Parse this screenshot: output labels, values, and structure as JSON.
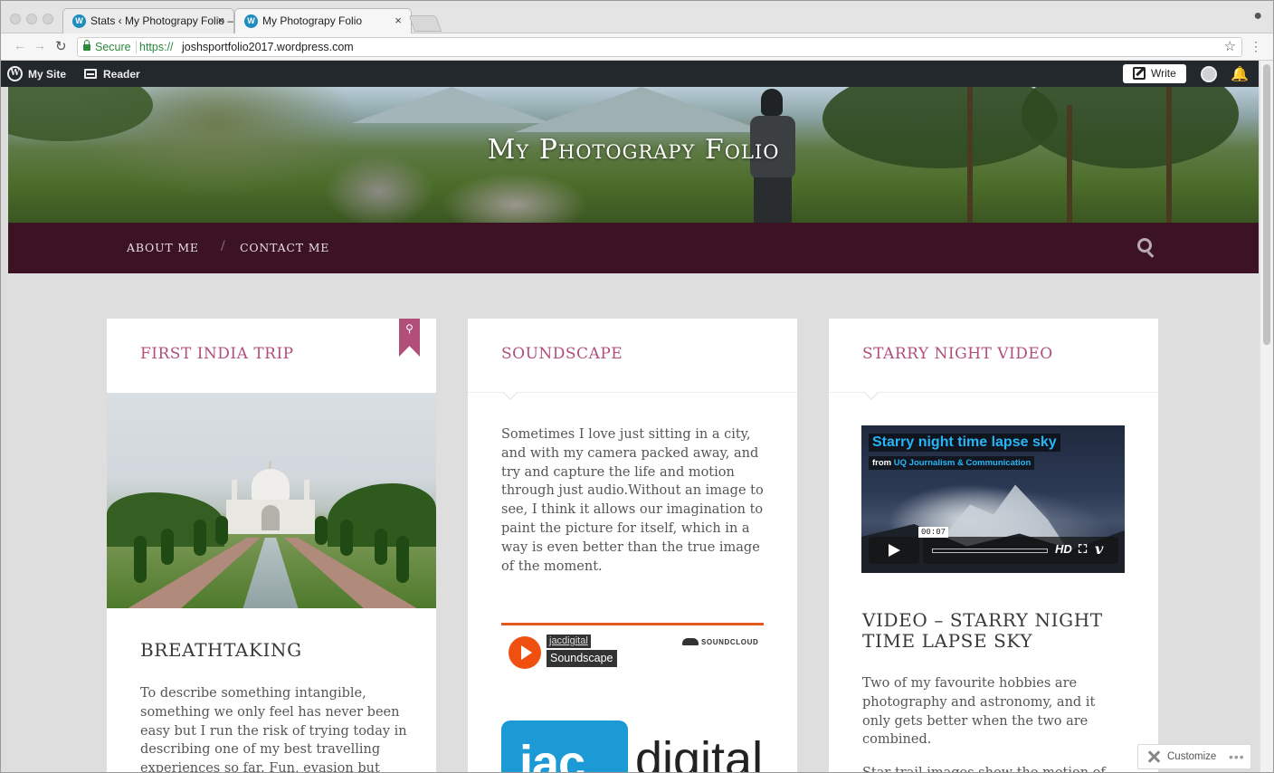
{
  "browser": {
    "tabs": [
      {
        "label": "Stats ‹ My Photograpy Folio —",
        "active": false
      },
      {
        "label": "My Photograpy Folio",
        "active": true
      }
    ],
    "tab_close_glyph": "×",
    "address": {
      "secure_label": "Secure",
      "scheme": "https://",
      "host": "joshsportfolio2017.wordpress.com"
    },
    "icons": [
      "back-arrow-icon",
      "forward-arrow-icon",
      "reload-icon",
      "lock-icon",
      "star-icon",
      "kebab-menu-icon",
      "profile-icon"
    ]
  },
  "admin_bar": {
    "my_site": "My Site",
    "reader": "Reader",
    "write": "Write",
    "bg_color": "#23282d"
  },
  "site": {
    "title": "My Photograpy Folio",
    "menu": [
      {
        "label": "ABOUT ME"
      },
      {
        "label": "CONTACT ME"
      }
    ],
    "menu_separator": "/",
    "menu_bg": "#3b1323",
    "accent_color": "#b24e7a"
  },
  "posts": [
    {
      "title": "FIRST INDIA TRIP",
      "sticky": true,
      "heading": "BREATHTAKING",
      "excerpt": "To describe something intangible, something we only feel has never been easy but I run the risk of trying today in describing one of my best travelling experiences so far. Fun, evasion but"
    },
    {
      "title": "SOUNDSCAPE",
      "excerpt": "Sometimes I love just sitting in a city, and with my camera packed away, and try and capture the life and motion through just audio.Without an image to see, I think it allows our imagination to paint the picture for itself, which in a way is even better than the true image of the moment.",
      "soundcloud": {
        "user": "jacdigital",
        "track": "Soundscape",
        "brand": "SOUNDCLOUD"
      },
      "logo": {
        "part1": "jac",
        "part2": "digital"
      }
    },
    {
      "title": "STARRY NIGHT VIDEO",
      "video": {
        "title": "Starry night time lapse sky",
        "from_prefix": "from",
        "from_source": "UQ Journalism & Communication",
        "time": "00:07",
        "hd": "HD"
      },
      "heading": "VIDEO – STARRY NIGHT TIME LAPSE SKY",
      "excerpt": "Two of my favourite hobbies are photography and astronomy, and it only gets better when the two are combined.",
      "excerpt2": "Star trail images show the motion of"
    }
  ],
  "customize": {
    "label": "Customize",
    "more": "•••"
  }
}
